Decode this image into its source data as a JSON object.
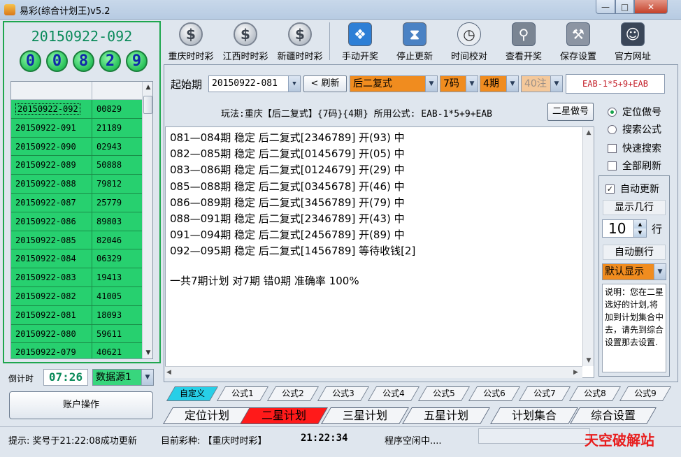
{
  "window": {
    "title": "易彩(综合计划王)v5.2",
    "min_glyph": "—",
    "max_glyph": "□",
    "close_glyph": "✕"
  },
  "left": {
    "current_period": "20150922-092",
    "balls": [
      "0",
      "0",
      "8",
      "2",
      "9"
    ],
    "rows": [
      {
        "period": "20150922-092",
        "code": "00829"
      },
      {
        "period": "20150922-091",
        "code": "21189"
      },
      {
        "period": "20150922-090",
        "code": "02943"
      },
      {
        "period": "20150922-089",
        "code": "50888"
      },
      {
        "period": "20150922-088",
        "code": "79812"
      },
      {
        "period": "20150922-087",
        "code": "25779"
      },
      {
        "period": "20150922-086",
        "code": "89803"
      },
      {
        "period": "20150922-085",
        "code": "82046"
      },
      {
        "period": "20150922-084",
        "code": "06329"
      },
      {
        "period": "20150922-083",
        "code": "19413"
      },
      {
        "period": "20150922-082",
        "code": "41005"
      },
      {
        "period": "20150922-081",
        "code": "18093"
      },
      {
        "period": "20150922-080",
        "code": "59611"
      },
      {
        "period": "20150922-079",
        "code": "40621"
      }
    ],
    "countdown_label": "倒计时",
    "countdown_value": "07:26",
    "datasource": "数据源1",
    "account_button": "账户操作"
  },
  "toolbar": [
    {
      "label": "重庆时时彩",
      "icon": "dollar-coin-icon",
      "glyph": "$"
    },
    {
      "label": "江西时时彩",
      "icon": "dollar-coin-icon",
      "glyph": "$"
    },
    {
      "label": "新疆时时彩",
      "icon": "dollar-coin-icon",
      "glyph": "$"
    },
    {
      "label": "手动开奖",
      "icon": "windows-logo-icon",
      "glyph": "❖"
    },
    {
      "label": "停止更新",
      "icon": "hourglass-window-icon",
      "glyph": "⧗"
    },
    {
      "label": "时间校对",
      "icon": "clock-icon",
      "glyph": "◷"
    },
    {
      "label": "查看开奖",
      "icon": "binoculars-icon",
      "glyph": "⚲"
    },
    {
      "label": "保存设置",
      "icon": "tools-icon",
      "glyph": "⚒"
    },
    {
      "label": "官方网址",
      "icon": "person-icon",
      "glyph": "☺"
    }
  ],
  "controls": {
    "start_label": "起始期",
    "start_period": "20150922-081",
    "refresh_button": "< 刷新",
    "play_type": "后二复式",
    "codes": "7码",
    "periods": "4期",
    "bets": "40注",
    "formula": "EAB-1*5+9+EAB"
  },
  "play_info": "玩法:重庆【后二复式】{7码}{4期} 所用公式: EAB-1*5+9+EAB",
  "erxing_button": "二星做号",
  "results": {
    "lines": [
      "081—084期 稳定 后二复式[2346789] 开(93)  中",
      "082—085期 稳定 后二复式[0145679] 开(05)  中",
      "083—086期 稳定 后二复式[0124679] 开(29)  中",
      "085—088期 稳定 后二复式[0345678] 开(46)  中",
      "086—089期 稳定 后二复式[3456789] 开(79)  中",
      "088—091期 稳定 后二复式[2346789] 开(43)  中",
      "091—094期 稳定 后二复式[2456789] 开(89)  中",
      "092—095期 稳定 后二复式[1456789] 等待收钱[2]"
    ],
    "summary": "一共7期计划 对7期 错0期 准确率 100%"
  },
  "options": {
    "radio_position": "定位做号",
    "radio_search": "搜索公式",
    "check_quick": "快速搜索",
    "check_refresh_all": "全部刷新",
    "check_auto_update": "自动更新",
    "show_rows_label": "显示几行",
    "rows_value": "10",
    "rows_unit": "行",
    "auto_delete_label": "自动删行",
    "display_mode": "默认显示",
    "note": "说明：您在二星选好的计划,将加到计划集合中去，请先到综合设置那去设置."
  },
  "formula_tabs": [
    "自定义",
    "公式1",
    "公式2",
    "公式3",
    "公式4",
    "公式5",
    "公式6",
    "公式7",
    "公式8",
    "公式9"
  ],
  "plan_tabs": [
    "定位计划",
    "二星计划",
    "三星计划",
    "五星计划",
    "计划集合",
    "综合设置"
  ],
  "status": {
    "hint": "提示: 奖号于21:22:08成功更新",
    "lottery": "目前彩种: 【重庆时时彩】",
    "time": "21:22:34",
    "idle": "程序空闲中....",
    "watermark": "天空破解站"
  },
  "colors": {
    "row_green": "#27d06f",
    "orange_select": "#f08c1f",
    "active_plan_tab": "#ff1a1a",
    "active_formula_tab": "#27cfe7",
    "formula_text": "#c3202a"
  }
}
